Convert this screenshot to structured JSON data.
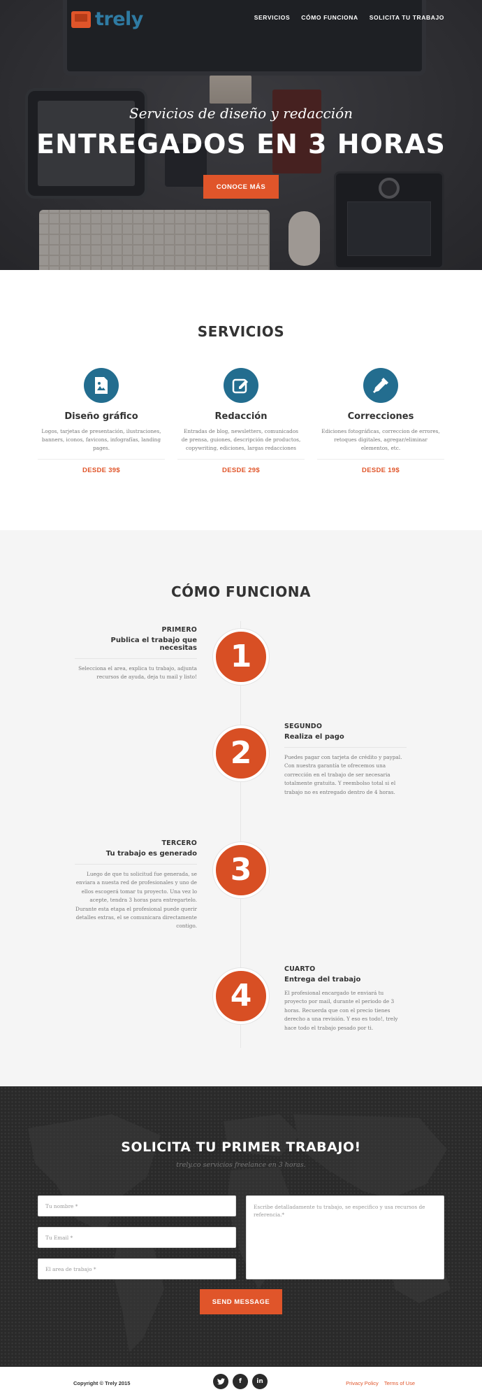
{
  "brand": {
    "name": "trely"
  },
  "nav": {
    "items": [
      "SERVICIOS",
      "CÓMO FUNCIONA",
      "SOLICITA TU TRABAJO"
    ]
  },
  "hero": {
    "subtitle": "Servicios de diseño y redacción",
    "title": "ENTREGADOS EN 3 HORAS",
    "cta": "CONOCE MÁS"
  },
  "services": {
    "title": "SERVICIOS",
    "items": [
      {
        "icon": "image-icon",
        "name": "Diseño gráfico",
        "desc": "Logos, tarjetas de presentación, ilustraciones, banners, iconos, favicons, infografías, landing pages.",
        "price": "DESDE 39$"
      },
      {
        "icon": "edit-icon",
        "name": "Redacción",
        "desc": "Entradas de blog, newsletters, comunicados de prensa, guiones, descripción de productos, copywriting, ediciones, largas redacciones",
        "price": "DESDE 29$"
      },
      {
        "icon": "eyedropper-icon",
        "name": "Correcciones",
        "desc": "Ediciones fotográficas, correccion de errores, retoques digitales, agregar/eliminar elementos, etc.",
        "price": "DESDE 19$"
      }
    ]
  },
  "how": {
    "title": "CÓMO FUNCIONA",
    "steps": [
      {
        "num": "1",
        "label": "PRIMERO",
        "heading": "Publica el trabajo que necesitas",
        "body": "Selecciona el area, explica tu trabajo, adjunta recursos de ayuda, deja tu mail y listo!"
      },
      {
        "num": "2",
        "label": "SEGUNDO",
        "heading": "Realiza el pago",
        "body": "Puedes pagar con tarjeta de crédito y paypal. Con nuestra garantía te ofrecemos una corrección en el trabajo de ser necesaria totalmente gratuita. Y reembolso total si el trabajo no es entregado dentro de 4 horas."
      },
      {
        "num": "3",
        "label": "TERCERO",
        "heading": "Tu trabajo es generado",
        "body": "Luego de que tu solicitud fue generada, se enviara a nuesta red de profesionales y uno de ellos escogerá tomar tu proyecto. Una vez lo acepte, tendra 3 horas para entregartelo. Durante esta etapa el profesional puede querir detalles extras, el se comunicara directamente contigo."
      },
      {
        "num": "4",
        "label": "CUARTO",
        "heading": "Entrega del trabajo",
        "body": "El profesional encargado te enviará tu proyecto por mail, durante el periodo de 3 horas. Recuerda que con el precio tienes derecho a una revisión. Y eso es todo!, trely hace todo el trabajo pesado por ti."
      }
    ]
  },
  "contact": {
    "title": "SOLICITA TU PRIMER TRABAJO!",
    "subtitle": "trely.co servicios freelance en 3 horas.",
    "name_placeholder": "Tu nombre *",
    "email_placeholder": "Tu Email *",
    "area_placeholder": "El area de trabajo *",
    "message_placeholder": "Escribe detalladamente tu trabajo, se especifico y usa recursos de referencia.*",
    "send": "SEND MESSAGE"
  },
  "footer": {
    "copyright": "Copyright © Trely 2015",
    "socials": [
      "twitter-icon",
      "facebook-icon",
      "linkedin-icon"
    ],
    "links": [
      "Privacy Policy",
      "Terms of Use"
    ]
  },
  "colors": {
    "accent": "#e0552a",
    "brand_blue": "#2f7ba3",
    "icon_blue": "#236d8f",
    "dark": "#2a2a2a"
  }
}
